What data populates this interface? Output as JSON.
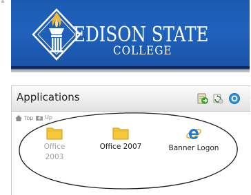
{
  "stray_mark": "a",
  "brand": {
    "line1": "EDISON STATE",
    "line2": "COLLEGE",
    "colors": {
      "banner": "#1f62bd",
      "rule": "#0f2a63",
      "logo_gold": "#f2b632"
    }
  },
  "portlet": {
    "title": "Applications",
    "header_icons": [
      "green-arrow-icon",
      "refresh-icon",
      "help-icon"
    ],
    "toolbar": {
      "top_label": "Top",
      "up_label": "Up"
    },
    "apps": [
      {
        "label_line1": "Office",
        "label_line2": "2003",
        "icon": "folder-icon",
        "enabled": false
      },
      {
        "label_line1": "Office 2007",
        "label_line2": "",
        "icon": "folder-icon",
        "enabled": true
      },
      {
        "label_line1": "Banner Logon",
        "label_line2": "",
        "icon": "internet-explorer-icon",
        "enabled": true
      }
    ]
  }
}
